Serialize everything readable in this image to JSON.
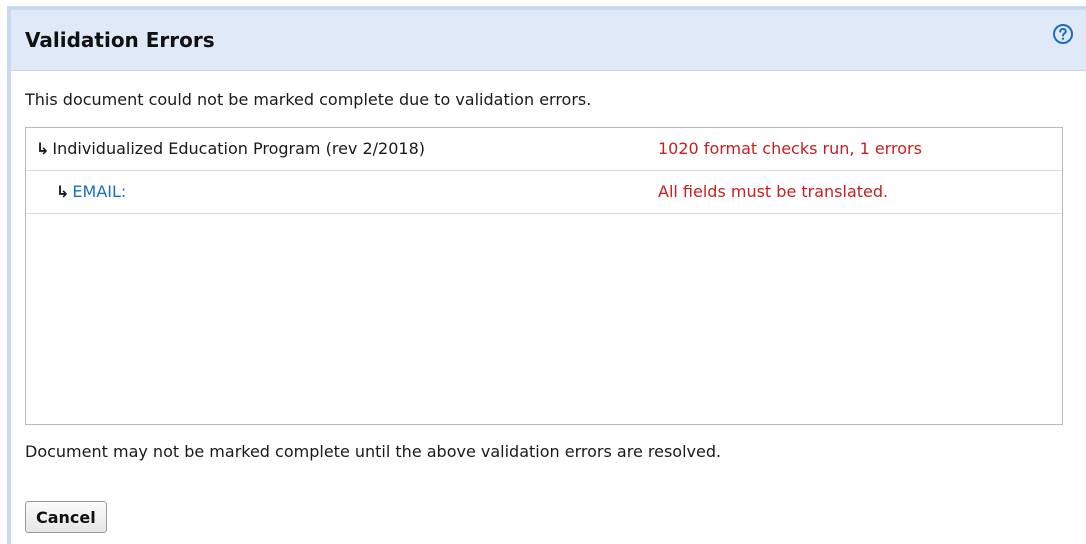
{
  "dialog": {
    "title": "Validation Errors",
    "help_icon": "question-circle-icon",
    "intro": "This document could not be marked complete due to validation errors."
  },
  "results": {
    "rows": [
      {
        "arrow": "↳",
        "label": "Individualized Education Program (rev 2/2018)",
        "message": "1020 format checks run, 1 errors"
      },
      {
        "arrow": "↳",
        "label": "EMAIL:",
        "message": "All fields must be translated."
      }
    ]
  },
  "footer": {
    "note": "Document may not be marked complete until the above validation errors are resolved.",
    "cancel_label": "Cancel"
  },
  "colors": {
    "header_bg": "#dfe9f8",
    "error_text": "#c81e1e",
    "link_text": "#1a6fc4",
    "help_icon": "#1a6fc4"
  }
}
